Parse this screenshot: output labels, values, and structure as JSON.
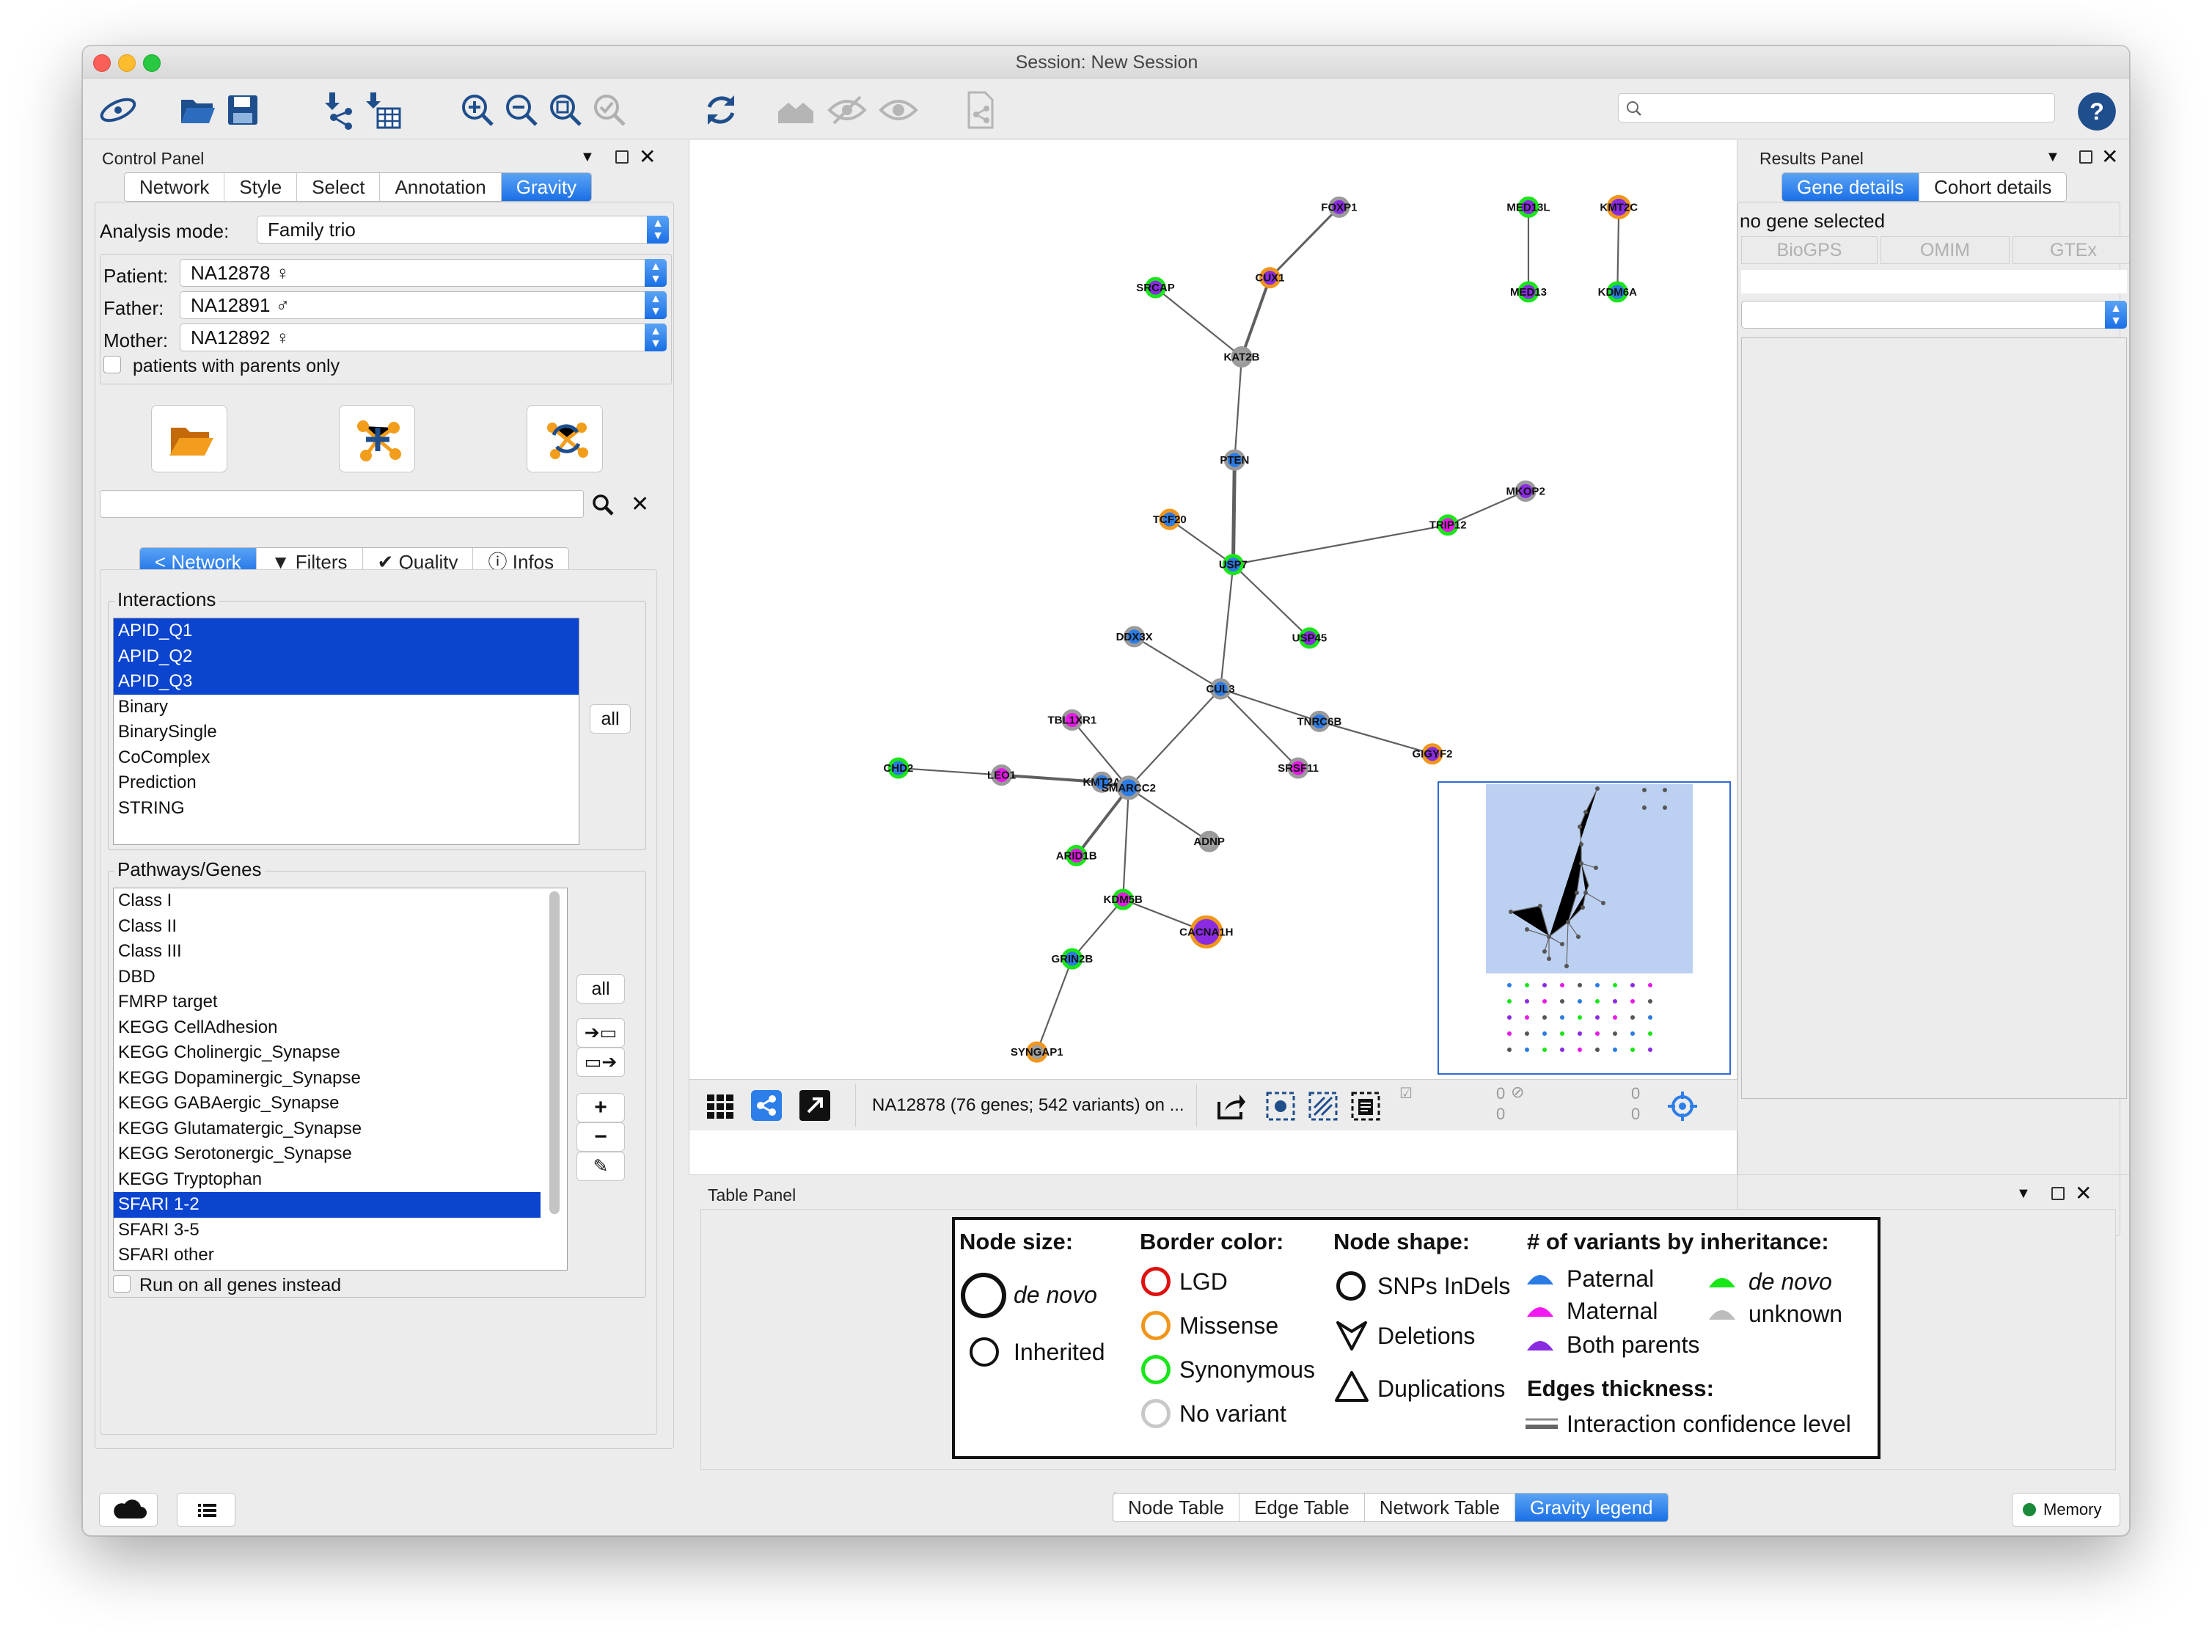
{
  "window": {
    "title": "Session: New Session"
  },
  "toolbar": {
    "icons": [
      "cytoscape-logo-icon",
      "open-session-icon",
      "save-session-icon",
      "import-network-icon",
      "import-table-icon",
      "zoom-in-icon",
      "zoom-out-icon",
      "zoom-fit-icon",
      "zoom-selected-icon",
      "refresh-icon",
      "home-icon",
      "hide-icon",
      "show-icon",
      "export-icon",
      "help-icon"
    ],
    "search_placeholder": ""
  },
  "control_panel": {
    "title": "Control Panel",
    "tabs": [
      "Network",
      "Style",
      "Select",
      "Annotation",
      "Gravity"
    ],
    "active_tab": "Gravity",
    "analysis_mode_label": "Analysis mode:",
    "analysis_mode_value": "Family trio",
    "patient_label": "Patient:",
    "patient_value": "NA12878 ♀",
    "father_label": "Father:",
    "father_value": "NA12891 ♂",
    "mother_label": "Mother:",
    "mother_value": "NA12892 ♀",
    "parents_only_label": "patients with parents only",
    "sub_tabs": [
      "Network",
      "Filters",
      "Quality",
      "Infos"
    ],
    "interactions_label": "Interactions",
    "interactions": [
      "APID_Q1",
      "APID_Q2",
      "APID_Q3",
      "Binary",
      "BinarySingle",
      "CoComplex",
      "Prediction",
      "STRING"
    ],
    "interactions_selected": [
      "APID_Q1",
      "APID_Q2",
      "APID_Q3"
    ],
    "all_label": "all",
    "pathways_label": "Pathways/Genes",
    "pathways": [
      "Class I",
      "Class II",
      "Class III",
      "DBD",
      "FMRP target",
      "KEGG CellAdhesion",
      "KEGG Cholinergic_Synapse",
      "KEGG Dopaminergic_Synapse",
      "KEGG GABAergic_Synapse",
      "KEGG Glutamatergic_Synapse",
      "KEGG Serotonergic_Synapse",
      "KEGG Tryptophan",
      "SFARI 1-2",
      "SFARI 3-5",
      "SFARI other"
    ],
    "pathways_selected": "SFARI 1-2",
    "run_all_label": "Run on all genes instead"
  },
  "network_view": {
    "status_text": "NA12878 (76 genes; 542 variants) on ...",
    "counts": [
      "0",
      "0",
      "0",
      "0"
    ]
  },
  "graph": {
    "nodes": [
      {
        "id": "FOXP1",
        "fill": "#8a2be2",
        "border": "#9a9a9a"
      },
      {
        "id": "MED13L",
        "fill": "#8a2be2",
        "border": "#19e619"
      },
      {
        "id": "KMT2C",
        "fill": "#8a2be2",
        "border": "#f0961a"
      },
      {
        "id": "CUX1",
        "fill": "#8a2be2",
        "border": "#f0961a"
      },
      {
        "id": "SRCAP",
        "fill": "#8a2be2",
        "border": "#19e619"
      },
      {
        "id": "MED13",
        "fill": "#8a2be2",
        "border": "#19e619"
      },
      {
        "id": "KDM6A",
        "fill": "#2a7be4",
        "border": "#19e619"
      },
      {
        "id": "KAT2B",
        "fill": "#a0a0a0",
        "border": "#9a9a9a"
      },
      {
        "id": "PTEN",
        "fill": "#2a7be4",
        "border": "#9a9a9a"
      },
      {
        "id": "MKOP2",
        "fill": "#8a2be2",
        "border": "#9a9a9a"
      },
      {
        "id": "TCF20",
        "fill": "#2a7be4",
        "border": "#f0961a"
      },
      {
        "id": "TRIP12",
        "fill": "#e619e6",
        "border": "#19e619"
      },
      {
        "id": "USP7",
        "fill": "#2a7be4",
        "border": "#19e619"
      },
      {
        "id": "DDX3X",
        "fill": "#2a7be4",
        "border": "#9a9a9a"
      },
      {
        "id": "USP45",
        "fill": "#8a2be2",
        "border": "#19e619"
      },
      {
        "id": "CUL3",
        "fill": "#2a7be4",
        "border": "#9a9a9a"
      },
      {
        "id": "TBL1XR1",
        "fill": "#e619e6",
        "border": "#9a9a9a"
      },
      {
        "id": "TNRC6B",
        "fill": "#2a7be4",
        "border": "#9a9a9a"
      },
      {
        "id": "CHD2",
        "fill": "#2a7be4",
        "border": "#19e619"
      },
      {
        "id": "LEO1",
        "fill": "#e619e6",
        "border": "#9a9a9a"
      },
      {
        "id": "KMT2A",
        "fill": "#2a7be4",
        "border": "#9a9a9a"
      },
      {
        "id": "SMARCC2",
        "fill": "#2a7be4",
        "border": "#9a9a9a"
      },
      {
        "id": "SRSF11",
        "fill": "#e619e6",
        "border": "#9a9a9a"
      },
      {
        "id": "GIGYF2",
        "fill": "#8a2be2",
        "border": "#f0961a"
      },
      {
        "id": "ADNP",
        "fill": "#a0a0a0",
        "border": "#9a9a9a"
      },
      {
        "id": "ARID1B",
        "fill": "#e619e6",
        "border": "#19e619"
      },
      {
        "id": "KDM5B",
        "fill": "#e619e6",
        "border": "#19e619"
      },
      {
        "id": "CACNA1H",
        "fill": "#8a2be2",
        "border": "#f0961a"
      },
      {
        "id": "GRIN2B",
        "fill": "#2a7be4",
        "border": "#19e619"
      },
      {
        "id": "SYNGAP1",
        "fill": "#a0a0a0",
        "border": "#f0961a"
      }
    ],
    "edges": [
      [
        "FOXP1",
        "CUX1"
      ],
      [
        "CUX1",
        "KAT2B"
      ],
      [
        "SRCAP",
        "KAT2B"
      ],
      [
        "KAT2B",
        "PTEN"
      ],
      [
        "PTEN",
        "USP7"
      ],
      [
        "TCF20",
        "USP7"
      ],
      [
        "TRIP12",
        "USP7"
      ],
      [
        "MKOP2",
        "TRIP12"
      ],
      [
        "USP7",
        "USP45"
      ],
      [
        "USP7",
        "CUL3"
      ],
      [
        "DDX3X",
        "CUL3"
      ],
      [
        "CUL3",
        "TNRC6B"
      ],
      [
        "TNRC6B",
        "GIGYF2"
      ],
      [
        "CUL3",
        "SRSF11"
      ],
      [
        "CUL3",
        "SMARCC2"
      ],
      [
        "TBL1XR1",
        "SMARCC2"
      ],
      [
        "CHD2",
        "LEO1"
      ],
      [
        "LEO1",
        "KMT2A"
      ],
      [
        "KMT2A",
        "SMARCC2"
      ],
      [
        "SMARCC2",
        "ADNP"
      ],
      [
        "SMARCC2",
        "ARID1B"
      ],
      [
        "SMARCC2",
        "KDM5B"
      ],
      [
        "KDM5B",
        "CACNA1H"
      ],
      [
        "KDM5B",
        "GRIN2B"
      ],
      [
        "GRIN2B",
        "SYNGAP1"
      ],
      [
        "MED13L",
        "MED13"
      ],
      [
        "KMT2C",
        "KDM6A"
      ]
    ]
  },
  "results_panel": {
    "title": "Results Panel",
    "tabs": [
      "Gene details",
      "Cohort details"
    ],
    "active_tab": "Gene details",
    "status": "no gene selected",
    "links": [
      "BioGPS",
      "OMIM",
      "GTEx"
    ]
  },
  "table_panel": {
    "title": "Table Panel",
    "tabs": [
      "Node Table",
      "Edge Table",
      "Network Table",
      "Gravity legend"
    ],
    "active_tab": "Gravity legend",
    "legend": {
      "node_size_title": "Node size:",
      "de_novo": "de novo",
      "inherited": "Inherited",
      "border_title": "Border color:",
      "border_items": [
        {
          "label": "LGD",
          "color": "#e01010"
        },
        {
          "label": "Missense",
          "color": "#f0961a"
        },
        {
          "label": "Synonymous",
          "color": "#19e619"
        },
        {
          "label": "No variant",
          "color": "#c8c8c8"
        }
      ],
      "shape_title": "Node shape:",
      "shape_items": [
        "SNPs InDels",
        "Deletions",
        "Duplications"
      ],
      "inherit_title": "# of variants by inheritance:",
      "inherit_items": [
        {
          "label": "Paternal",
          "color": "#2a7be4"
        },
        {
          "label": "Maternal",
          "color": "#f019f0"
        },
        {
          "label": "Both parents",
          "color": "#8a2be2"
        },
        {
          "label": "de novo",
          "color": "#19e619"
        },
        {
          "label": "unknown",
          "color": "#bdbdbd"
        }
      ],
      "edges_title": "Edges thickness:",
      "edges_item": "Interaction confidence level"
    }
  },
  "statusbar": {
    "memory_label": "Memory"
  }
}
